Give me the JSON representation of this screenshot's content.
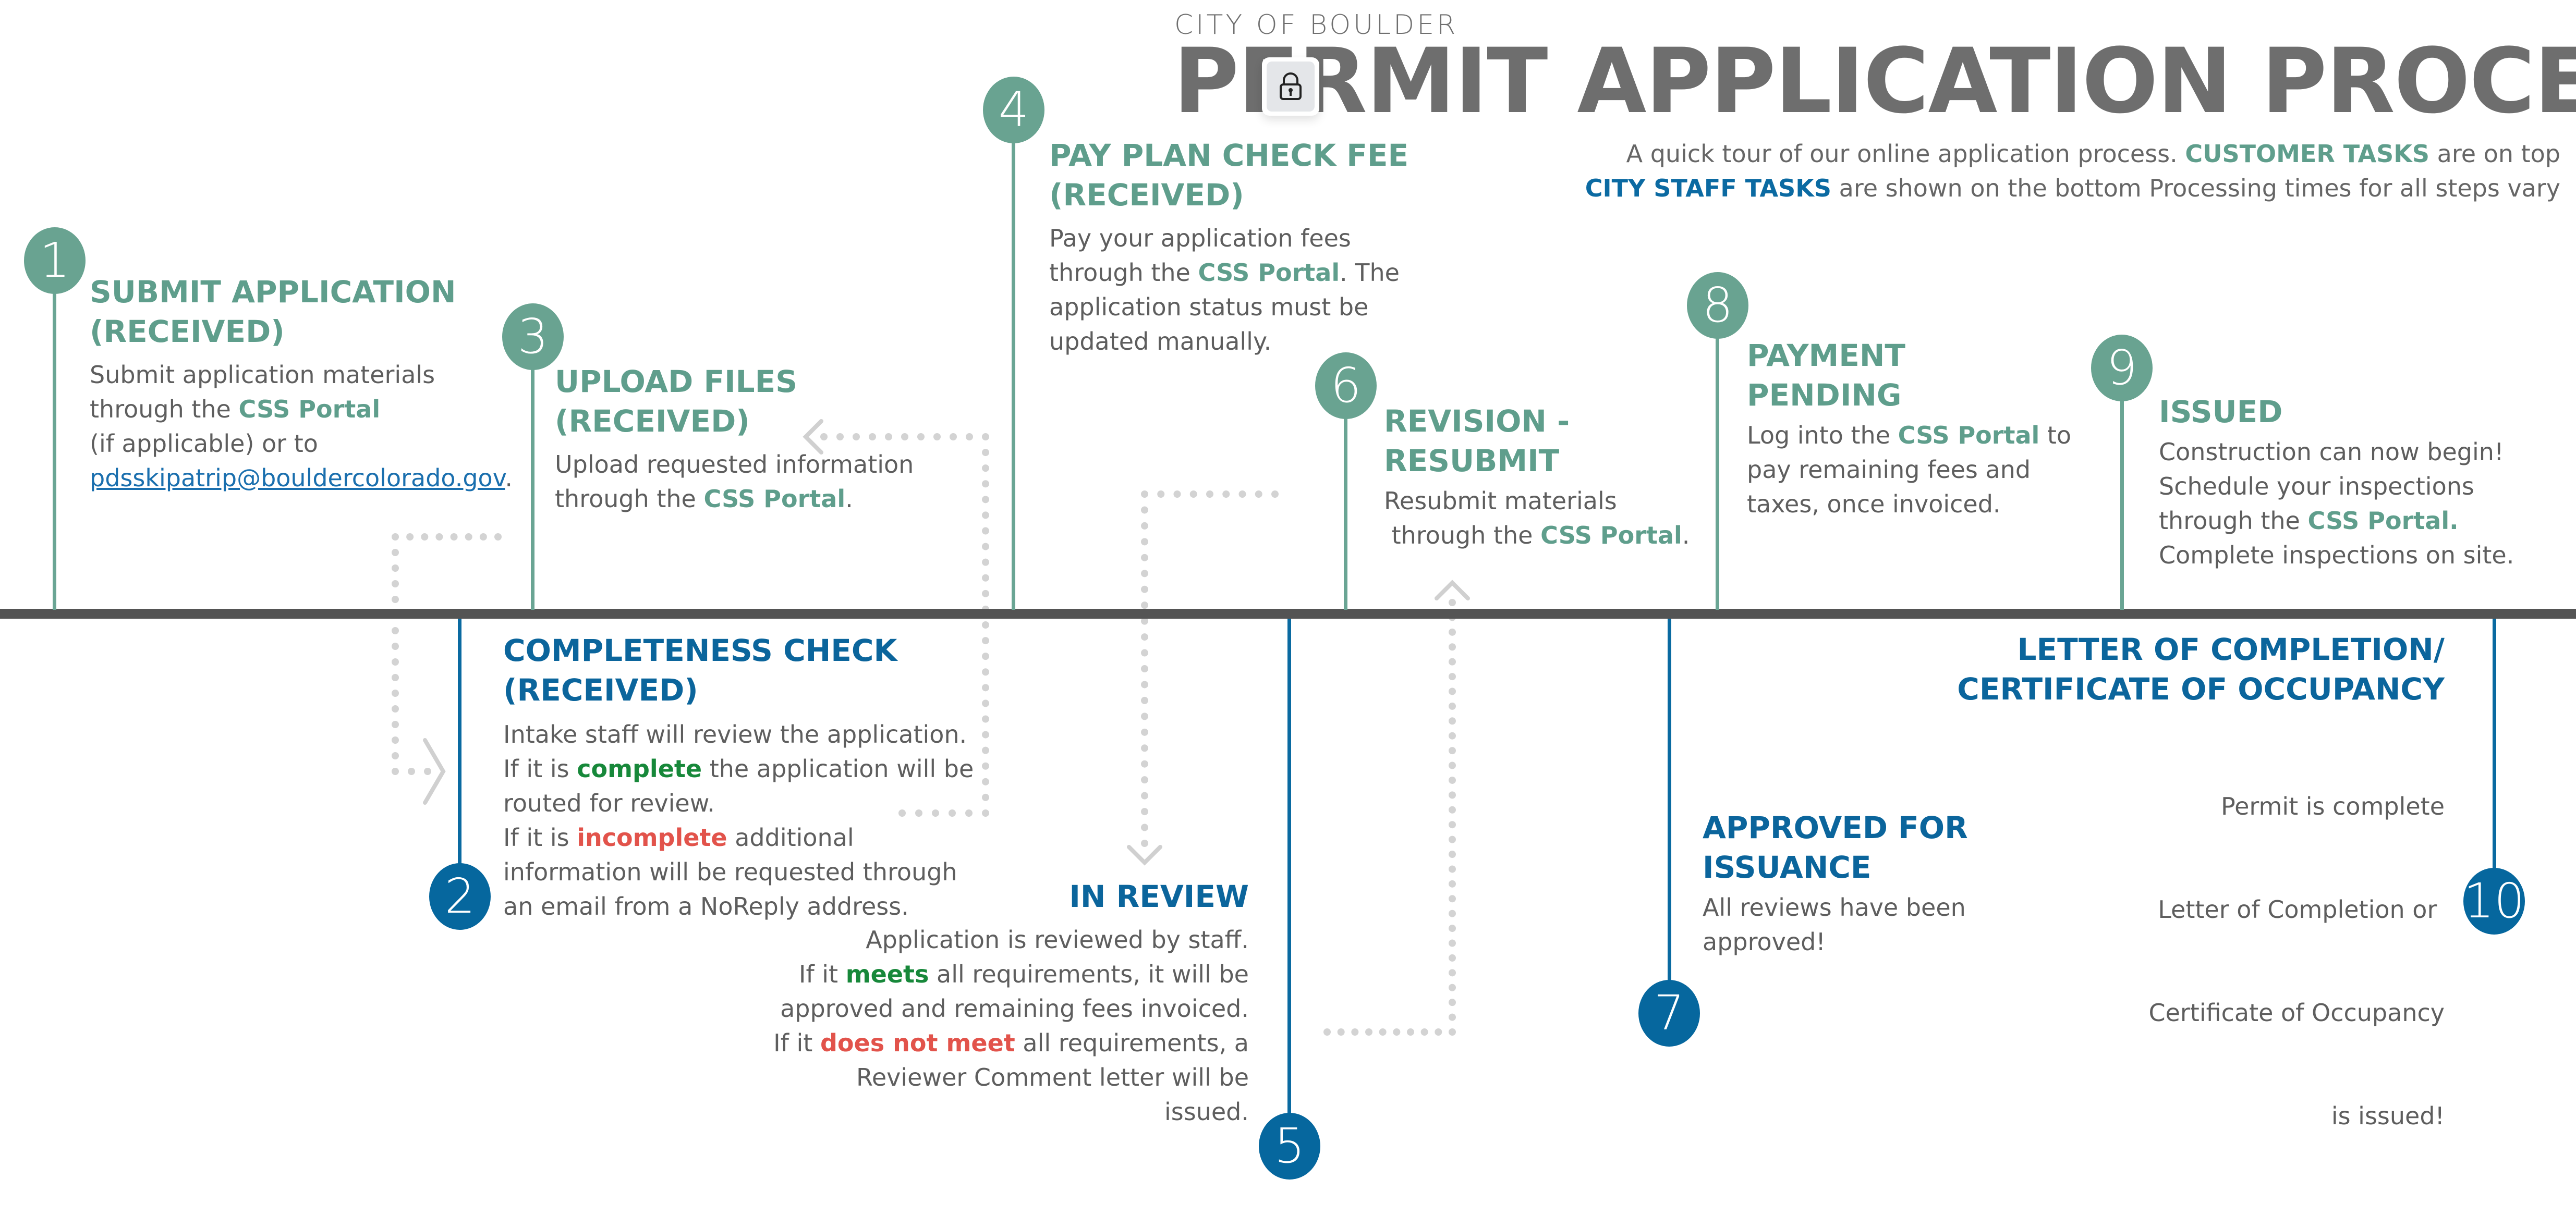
{
  "header": {
    "org": "CITY OF BOULDER",
    "title": "PERMIT APPLICATION PROCESS",
    "intro_line1_pre": "A quick tour of our online application process. ",
    "intro_line1_customer": "CUSTOMER TASKS",
    "intro_line1_post": " are on top",
    "intro_line2_staff": "CITY STAFF TASKS",
    "intro_line2_post": " are shown on the bottom Processing times for all steps vary"
  },
  "colors": {
    "customer": "#5f9e8c",
    "staff": "#0b659c",
    "timeline": "#545454",
    "positive": "#17883a",
    "negative": "#e2534b",
    "link": "#1a6fae"
  },
  "overlay": {
    "icon": "lock-icon"
  },
  "portal_label": "CSS Portal",
  "steps": [
    {
      "number": "1",
      "lane": "customer",
      "title_l1": "SUBMIT APPLICATION",
      "title_l2": "(RECEIVED)",
      "body_l1": "Submit application materials",
      "body_l2_pre": "through the ",
      "body_l3": "(if applicable) or to",
      "email": "pdsskipatrip@bouldercolorado.gov",
      "email_post": "."
    },
    {
      "number": "2",
      "lane": "staff",
      "title_l1": "COMPLETENESS CHECK",
      "title_l2": "(RECEIVED)",
      "body_l1": "Intake staff will review the application.",
      "body_l2_pre": "If it is ",
      "body_l2_hl": "complete",
      "body_l2_post": " the application will be",
      "body_l3": "routed for review.",
      "body_l4_pre": "If it is ",
      "body_l4_hl": "incomplete",
      "body_l4_post": " additional",
      "body_l5": "information will be requested through",
      "body_l6": "an email from a NoReply address."
    },
    {
      "number": "3",
      "lane": "customer",
      "title_l1": "UPLOAD FILES",
      "title_l2": "(RECEIVED)",
      "body_l1": "Upload requested information",
      "body_l2_pre": "through the ",
      "body_l2_post": "."
    },
    {
      "number": "4",
      "lane": "customer",
      "title_l1": "PAY PLAN CHECK FEE",
      "title_l2": "(RECEIVED)",
      "body_l1": "Pay your application fees",
      "body_l2_pre": "through the ",
      "body_l2_post": ". The",
      "body_l3": "application status must be",
      "body_l4": "updated manually."
    },
    {
      "number": "5",
      "lane": "staff",
      "title_l1": "IN REVIEW",
      "body_l1": "Application is reviewed by staff.",
      "body_l2_pre": "If it ",
      "body_l2_hl": "meets",
      "body_l2_post": " all requirements, it will be",
      "body_l3": "approved and remaining fees invoiced.",
      "body_l4_pre": "If it ",
      "body_l4_hl": "does not meet",
      "body_l4_post": " all requirements, a",
      "body_l5": "Reviewer Comment letter will be",
      "body_l6": "issued."
    },
    {
      "number": "6",
      "lane": "customer",
      "title_l1": "REVISION -",
      "title_l2": "RESUBMIT",
      "body_l1": "Resubmit materials",
      "body_l2_pre": " through the ",
      "body_l2_post": "."
    },
    {
      "number": "7",
      "lane": "staff",
      "title_l1": "APPROVED FOR",
      "title_l2": "ISSUANCE",
      "body_l1": "All reviews have been",
      "body_l2": "approved!"
    },
    {
      "number": "8",
      "lane": "customer",
      "title_l1": "PAYMENT",
      "title_l2": "PENDING",
      "body_l1_pre": "Log into the ",
      "body_l1_post": " to",
      "body_l2": "pay remaining fees and",
      "body_l3": "taxes, once invoiced."
    },
    {
      "number": "9",
      "lane": "customer",
      "title_l1": "ISSUED",
      "body_l1": "Construction can now begin!",
      "body_l2": "Schedule your inspections",
      "body_l3_pre": "through the ",
      "body_l3_portal": "CSS Portal.",
      "body_l4": "Complete inspections on site."
    },
    {
      "number": "10",
      "lane": "staff",
      "title_l1": "LETTER OF COMPLETION/",
      "title_l2": "CERTIFICATE OF OCCUPANCY",
      "body_l1": "Permit is complete",
      "body_l2": "Letter of Completion or ",
      "body_l3": "Certificate of Occupancy",
      "body_l4": "is issued!"
    }
  ]
}
